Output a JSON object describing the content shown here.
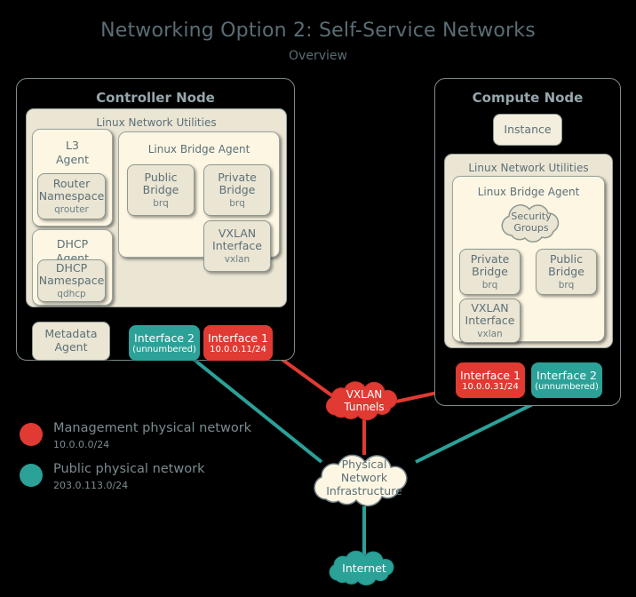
{
  "title": "Networking Option 2: Self-Service Networks",
  "subtitle": "Overview",
  "colors": {
    "management_red": "#e03a33",
    "public_teal": "#2ba198",
    "panel_outer": "#ebe5d3",
    "panel_inner": "#fdf6e3",
    "text": "#5c7078",
    "node_border": "#7e8a8c",
    "background": "#000000"
  },
  "controller_node": {
    "title": "Controller Node",
    "utilities_title": "Linux Network Utilities",
    "l3_agent": {
      "line1": "L3",
      "line2": "Agent",
      "namespace_line1": "Router",
      "namespace_line2": "Namespace",
      "namespace_sub": "qrouter"
    },
    "dhcp_agent": {
      "line1": "DHCP",
      "line2": "Agent",
      "namespace_line1": "DHCP",
      "namespace_line2": "Namespace",
      "namespace_sub": "qdhcp"
    },
    "bridge_agent_title": "Linux Bridge Agent",
    "public_bridge": {
      "line1": "Public",
      "line2": "Bridge",
      "sub": "brq"
    },
    "private_bridge": {
      "line1": "Private",
      "line2": "Bridge",
      "sub": "brq"
    },
    "vxlan_interface": {
      "line1": "VXLAN",
      "line2": "Interface",
      "sub": "vxlan"
    },
    "metadata_agent": {
      "line1": "Metadata",
      "line2": "Agent"
    },
    "interface2": {
      "label": "Interface 2",
      "sub": "(unnumbered)"
    },
    "interface1": {
      "label": "Interface 1",
      "sub": "10.0.0.11/24"
    }
  },
  "compute_node": {
    "title": "Compute Node",
    "instance": "Instance",
    "utilities_title": "Linux Network Utilities",
    "bridge_agent_title": "Linux Bridge Agent",
    "security_groups": {
      "line1": "Security",
      "line2": "Groups"
    },
    "private_bridge": {
      "line1": "Private",
      "line2": "Bridge",
      "sub": "brq"
    },
    "public_bridge": {
      "line1": "Public",
      "line2": "Bridge",
      "sub": "brq"
    },
    "vxlan_interface": {
      "line1": "VXLAN",
      "line2": "Interface",
      "sub": "vxlan"
    },
    "interface1": {
      "label": "Interface 1",
      "sub": "10.0.0.31/24"
    },
    "interface2": {
      "label": "Interface 2",
      "sub": "(unnumbered)"
    }
  },
  "clouds": {
    "vxlan_tunnels": {
      "line1": "VXLAN",
      "line2": "Tunnels"
    },
    "physical_network": {
      "line1": "Physical",
      "line2": "Network",
      "line3": "Infrastructure"
    },
    "internet": {
      "line1": "Internet"
    }
  },
  "legend": {
    "items": [
      {
        "name": "Management physical network",
        "cidr": "10.0.0.0/24",
        "color": "#e03a33"
      },
      {
        "name": "Public physical network",
        "cidr": "203.0.113.0/24",
        "color": "#2ba198"
      }
    ]
  }
}
